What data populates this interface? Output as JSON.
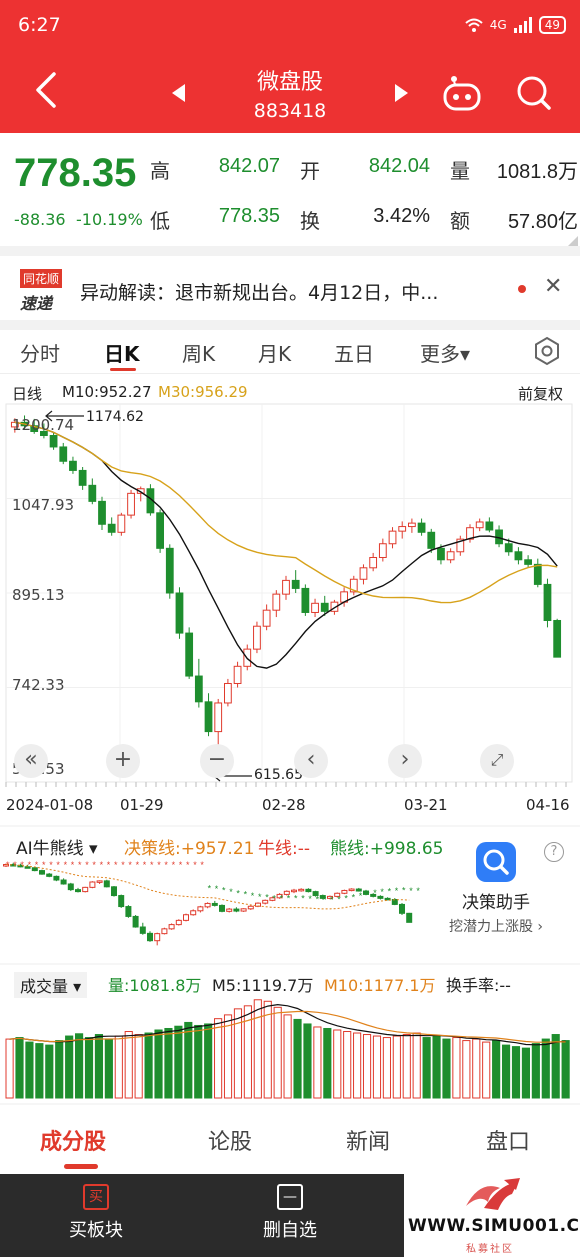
{
  "status": {
    "time": "6:27",
    "signal": "4G",
    "battery": "49"
  },
  "header": {
    "title": "微盘股",
    "code": "883418"
  },
  "quote": {
    "price": "778.35",
    "change": "-88.36",
    "change_pct": "-10.19%",
    "high_label": "高",
    "high": "842.07",
    "open_label": "开",
    "open": "842.04",
    "volume_label": "量",
    "volume": "1081.8万",
    "low_label": "低",
    "low": "778.35",
    "turnover_label": "换",
    "turnover": "3.42%",
    "amount_label": "额",
    "amount": "57.80亿"
  },
  "news": {
    "logo_top": "同花顺",
    "logo_bottom": "速递",
    "text": "异动解读：退市新规出台。4月12日，中..."
  },
  "tabs": [
    "分时",
    "日K",
    "周K",
    "月K",
    "五日",
    "更多▾"
  ],
  "kline": {
    "label": "日线",
    "ma10": "M10:952.27",
    "ma30": "M30:956.29",
    "restore": "前复权",
    "ticks": [
      "1200.74",
      "1047.93",
      "895.13",
      "742.33",
      "589.53"
    ],
    "dates": [
      "2024-01-08",
      "01-29",
      "02-28",
      "03-21",
      "04-16"
    ],
    "high_mark": "1174.62",
    "low_mark": "615.65"
  },
  "ai": {
    "title": "AI牛熊线 ▾",
    "decision": "决策线:+957.21",
    "bull": "牛线:--",
    "bear": "熊线:+998.65",
    "assistant_title": "决策助手",
    "assistant_sub": "挖潜力上涨股 ›",
    "help": "?"
  },
  "volume": {
    "title": "成交量 ▾",
    "vol": "量:1081.8万",
    "m5": "M5:1119.7万",
    "m10": "M10:1177.1万",
    "turnover": "换手率:--"
  },
  "bottom_tabs": [
    "成分股",
    "论股",
    "新闻",
    "盘口"
  ],
  "footer": {
    "buy": "买板块",
    "remove": "删自选",
    "buy_icon": "买",
    "remove_icon": "—"
  },
  "watermark": {
    "text": "WWW.SIMU001.CN",
    "sub": "私募社区"
  },
  "colors": {
    "up": "#e03a2c",
    "down": "#1e8e2e",
    "ma10": "#111111",
    "ma30": "#d7a21b"
  },
  "chart_data": {
    "type": "candlestick",
    "categories_note": "",
    "candles": [
      [
        1180,
        1195,
        1170,
        1188
      ],
      [
        1188,
        1200,
        1176,
        1182
      ],
      [
        1182,
        1194,
        1168,
        1172
      ],
      [
        1172,
        1186,
        1160,
        1165
      ],
      [
        1165,
        1170,
        1140,
        1145
      ],
      [
        1145,
        1152,
        1115,
        1120
      ],
      [
        1120,
        1128,
        1098,
        1104
      ],
      [
        1104,
        1110,
        1070,
        1078
      ],
      [
        1078,
        1090,
        1045,
        1050
      ],
      [
        1050,
        1058,
        1000,
        1010
      ],
      [
        1010,
        1022,
        990,
        996
      ],
      [
        996,
        1030,
        990,
        1026
      ],
      [
        1026,
        1070,
        1020,
        1064
      ],
      [
        1064,
        1076,
        1050,
        1072
      ],
      [
        1072,
        1080,
        1025,
        1030
      ],
      [
        1030,
        1036,
        960,
        968
      ],
      [
        968,
        975,
        880,
        890
      ],
      [
        890,
        900,
        810,
        820
      ],
      [
        820,
        830,
        740,
        745
      ],
      [
        745,
        775,
        690,
        700
      ],
      [
        700,
        715,
        640,
        648
      ],
      [
        648,
        705,
        615,
        698
      ],
      [
        698,
        740,
        692,
        732
      ],
      [
        732,
        770,
        725,
        762
      ],
      [
        762,
        800,
        755,
        792
      ],
      [
        792,
        840,
        785,
        832
      ],
      [
        832,
        870,
        825,
        860
      ],
      [
        860,
        895,
        848,
        888
      ],
      [
        888,
        920,
        878,
        912
      ],
      [
        912,
        930,
        890,
        898
      ],
      [
        898,
        905,
        850,
        856
      ],
      [
        856,
        880,
        848,
        872
      ],
      [
        872,
        885,
        850,
        858
      ],
      [
        858,
        878,
        852,
        874
      ],
      [
        874,
        900,
        866,
        892
      ],
      [
        892,
        920,
        886,
        914
      ],
      [
        914,
        940,
        905,
        934
      ],
      [
        934,
        960,
        928,
        952
      ],
      [
        952,
        985,
        945,
        976
      ],
      [
        976,
        1005,
        968,
        998
      ],
      [
        998,
        1015,
        985,
        1006
      ],
      [
        1006,
        1020,
        995,
        1012
      ],
      [
        1012,
        1020,
        990,
        996
      ],
      [
        996,
        1002,
        960,
        968
      ],
      [
        968,
        975,
        940,
        948
      ],
      [
        948,
        968,
        942,
        962
      ],
      [
        962,
        990,
        955,
        984
      ],
      [
        984,
        1010,
        978,
        1004
      ],
      [
        1004,
        1020,
        998,
        1014
      ],
      [
        1014,
        1022,
        996,
        1000
      ],
      [
        1000,
        1008,
        970,
        976
      ],
      [
        976,
        985,
        955,
        962
      ],
      [
        962,
        970,
        940,
        948
      ],
      [
        948,
        956,
        935,
        940
      ],
      [
        940,
        950,
        900,
        905
      ],
      [
        905,
        915,
        830,
        842
      ],
      [
        842,
        845,
        778,
        778
      ]
    ],
    "ylim": [
      560,
      1220
    ],
    "ma10_note": "M10 line",
    "ma30_note": "M30 line",
    "volumes": [
      78,
      80,
      74,
      72,
      70,
      76,
      82,
      85,
      80,
      84,
      78,
      82,
      88,
      84,
      86,
      90,
      92,
      95,
      100,
      96,
      98,
      105,
      110,
      118,
      122,
      130,
      128,
      120,
      110,
      104,
      98,
      94,
      92,
      90,
      88,
      86,
      84,
      82,
      80,
      82,
      84,
      86,
      80,
      82,
      78,
      80,
      76,
      78,
      74,
      76,
      70,
      68,
      66,
      72,
      78,
      84,
      76
    ],
    "volume_colors_up": [
      true,
      false,
      false,
      false,
      false,
      false,
      false,
      false,
      false,
      false,
      false,
      true,
      true,
      true,
      false,
      false,
      false,
      false,
      false,
      false,
      false,
      true,
      true,
      true,
      true,
      true,
      true,
      true,
      true,
      false,
      false,
      true,
      false,
      true,
      true,
      true,
      true,
      true,
      true,
      true,
      true,
      true,
      false,
      false,
      false,
      true,
      true,
      true,
      true,
      false,
      false,
      false,
      false,
      false,
      false,
      false,
      false
    ]
  }
}
